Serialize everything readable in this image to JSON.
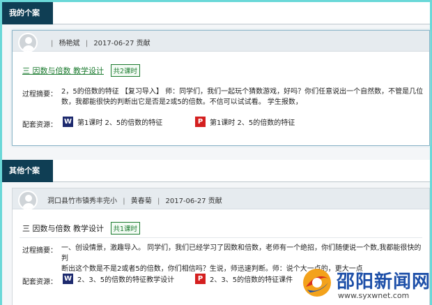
{
  "sections": {
    "mine": {
      "tab": "我的个案"
    },
    "others": {
      "tab": "其他个案"
    }
  },
  "cards": [
    {
      "author": "杨艳斌",
      "date_text": "2017-06-27 贡献",
      "title": "三 因数与倍数 教学设计",
      "badge": "共2课时",
      "summary_label": "过程摘要：",
      "summary_lines": [
        "2，5的倍数的特征 【复习导入】 师：同学们，我们一起玩个猜数游戏，好吗？你们任意说出一个自然数，不管是几位",
        "数，我都能很快的判断出它是否是2或5的倍数。不信可以试试看。 学生报数，"
      ],
      "resources_label": "配套资源：",
      "resources": [
        {
          "type": "W",
          "icon": "word-doc-icon",
          "label": "第1课时 2、5的倍数的特征"
        },
        {
          "type": "P",
          "icon": "ppt-doc-icon",
          "label": "第1课时 2、5的倍数的特征"
        }
      ]
    },
    {
      "author": "洞口县竹市镇秀丰完小",
      "author2": "黄春菊",
      "date_text": "2017-06-27 贡献",
      "title": "三 因数与倍数 教学设计",
      "badge": "共1课时",
      "summary_label": "过程摘要：",
      "summary_lines": [
        "一、创设情景，激趣导入。 同学们，我们已经学习了因数和倍数，老师有一个绝招，你们随便说一个数,我都能很快的判",
        "断出这个数是不是2或者5的倍数，你们相信吗？生说，师迅速判断。师：说个大一点的，更大一点"
      ],
      "resources_label": "配套资源：",
      "resources": [
        {
          "type": "W",
          "icon": "word-doc-icon",
          "label": "2、3、5的倍数的特征教学设计"
        },
        {
          "type": "P",
          "icon": "ppt-doc-icon",
          "label": "2、3、5的倍数的特征课件"
        }
      ]
    }
  ],
  "watermark": {
    "name": "邵阳新闻网",
    "url": "www.syxwnet.com"
  },
  "colors": {
    "tab_bg": "#0f3e54",
    "title_green": "#1a7a2e",
    "word_blue": "#1d2a6e",
    "ppt_red": "#d41f1f",
    "frame_cyan": "#6ad8d8"
  }
}
